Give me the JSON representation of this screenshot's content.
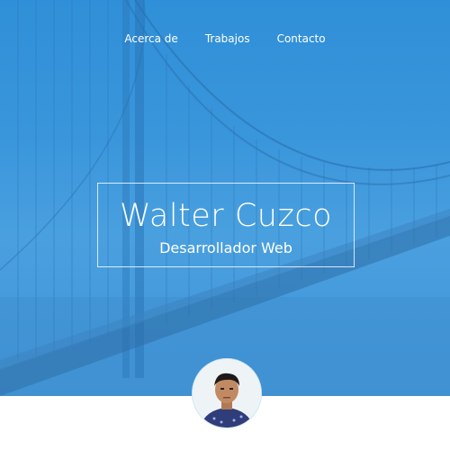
{
  "nav": {
    "items": [
      {
        "label": "Acerca de"
      },
      {
        "label": "Trabajos"
      },
      {
        "label": "Contacto"
      }
    ]
  },
  "hero": {
    "name": "Walter Cuzco",
    "role": "Desarrollador Web"
  },
  "avatar": {
    "description_icon": "profile-photo"
  },
  "colors": {
    "hero_overlay": "#3a96db",
    "text": "#ffffff",
    "page_bg": "#ffffff"
  }
}
